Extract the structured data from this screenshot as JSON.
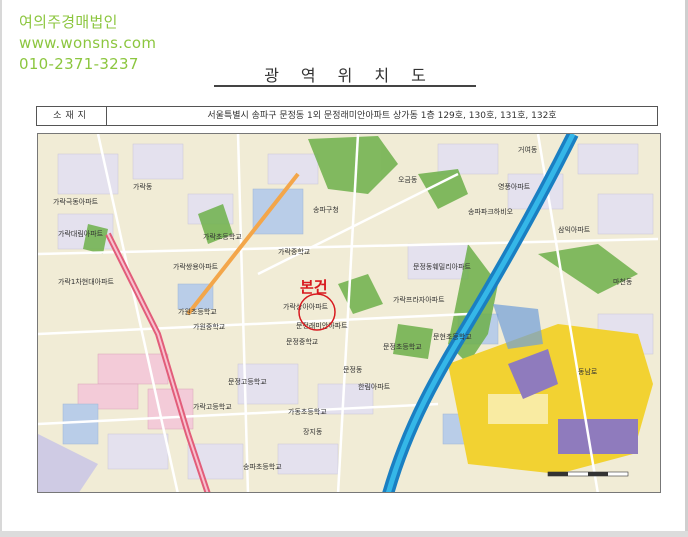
{
  "brand": {
    "name": "여의주경매법인",
    "website": "www.wonsns.com",
    "phone": "010-2371-3237"
  },
  "title": "광역위치도",
  "address": {
    "label": "소재지",
    "value": "서울특별시 송파구 문정동 1외 문정래미안아파트 상가동 1층 129호, 130호, 131호, 132호"
  },
  "map": {
    "marker_label": "본건",
    "labels": [
      "가락극동아파트",
      "가락대림아파트",
      "가락1차현대아파트",
      "가락쌍용아파트",
      "가락프라자아파트",
      "가락상아아파트",
      "송파구청",
      "문정동훼밀리아파트",
      "문정래미안아파트",
      "문정중학교",
      "문정초등학교",
      "문정고등학교",
      "가락고등학교",
      "가락초등학교",
      "가락중학교",
      "가원초등학교",
      "가원중학교",
      "오금동",
      "문정동",
      "장지동",
      "가락동",
      "가동초등학교",
      "송파초등학교",
      "문현초등학교",
      "거여동",
      "마천동",
      "영풍아파트",
      "송파파크하비오",
      "한림아파트",
      "동남로",
      "삼익아파트"
    ]
  },
  "colors": {
    "brand": "#8cc63f",
    "marker": "#d8191f",
    "highway": "#1a7fc2",
    "park": "#6db04a",
    "industrial": "#f2d232"
  }
}
